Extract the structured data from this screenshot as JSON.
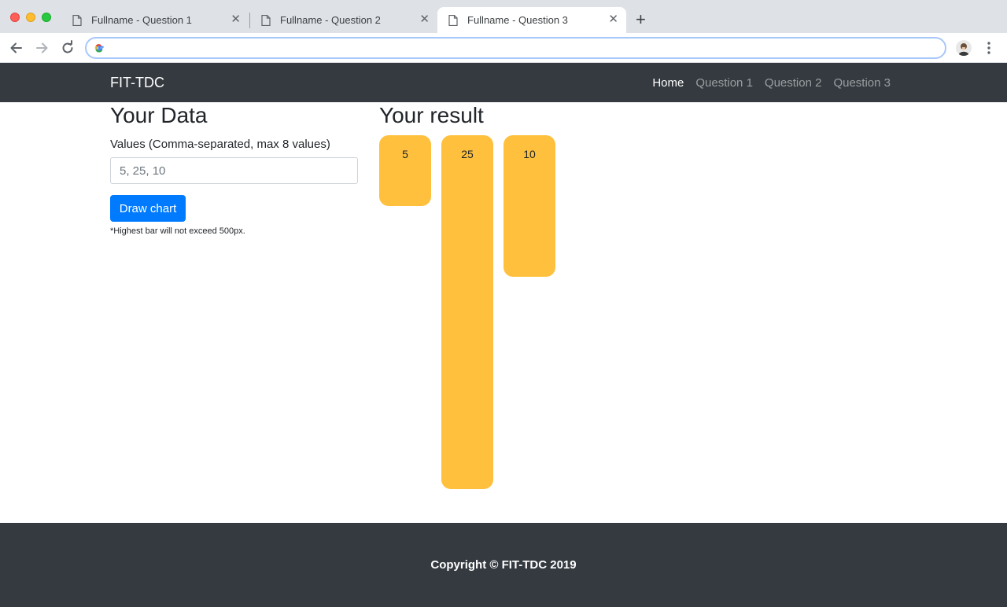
{
  "browser": {
    "tabs": [
      {
        "title": "Fullname - Question 1"
      },
      {
        "title": "Fullname - Question 2"
      },
      {
        "title": "Fullname - Question 3"
      }
    ],
    "url": ""
  },
  "navbar": {
    "brand": "FIT-TDC",
    "links": [
      "Home",
      "Question 1",
      "Question 2",
      "Question 3"
    ],
    "active": "Home"
  },
  "form": {
    "heading": "Your Data",
    "label": "Values (Comma-separated, max 8 values)",
    "input_placeholder": "5, 25, 10",
    "button_label": "Draw chart",
    "note": "*Highest bar will not exceed 500px."
  },
  "result": {
    "heading": "Your result"
  },
  "chart_data": {
    "type": "bar",
    "values": [
      5,
      25,
      10
    ],
    "labels": [
      "5",
      "25",
      "10"
    ],
    "bar_color": "#ffc03d"
  },
  "footer": {
    "copyright": "Copyright © FIT-TDC 2019"
  },
  "colors": {
    "navbar_bg": "#343a40",
    "primary": "#007bff",
    "bar": "#ffc03d"
  }
}
